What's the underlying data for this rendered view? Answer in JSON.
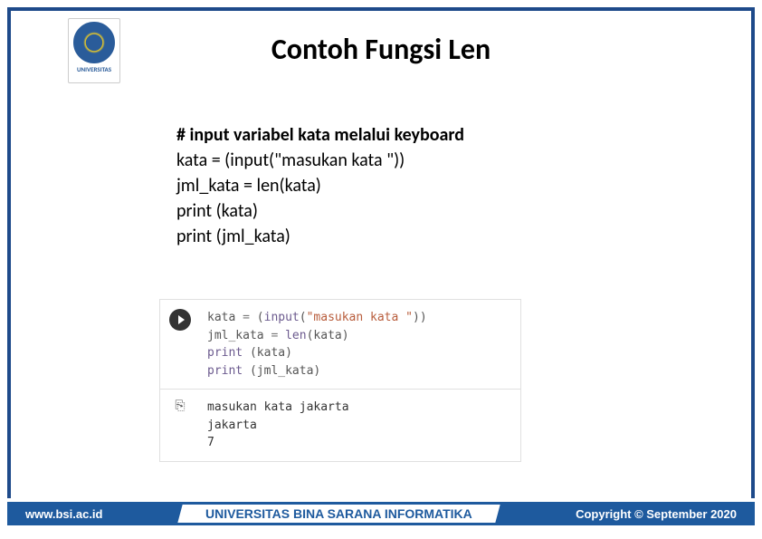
{
  "logo": {
    "label": "UNIVERSITAS"
  },
  "title": "Contoh Fungsi Len",
  "content": {
    "comment": "# input variabel kata melalui keyboard",
    "line2": "kata = (input(\"masukan kata \"))",
    "line3": "jml_kata = len(kata)",
    "line4": "print (kata)",
    "line5": "print (jml_kata)"
  },
  "code": {
    "line1": {
      "var": "kata",
      "eq": " = ",
      "open": "(",
      "fn": "input",
      "popen": "(",
      "str": "\"masukan kata \"",
      "pclose": "))"
    },
    "line2": {
      "var": "jml_kata",
      "eq": " = ",
      "fn": "len",
      "popen": "(",
      "arg": "kata",
      "pclose": ")"
    },
    "line3": {
      "fn": "print",
      "sp": " ",
      "popen": "(",
      "arg": "kata",
      "pclose": ")"
    },
    "line4": {
      "fn": "print",
      "sp": " ",
      "popen": "(",
      "arg": "jml_kata",
      "pclose": ")"
    }
  },
  "output": {
    "line1": "masukan kata jakarta",
    "line2": "jakarta",
    "line3": "7"
  },
  "footer": {
    "left": "www.bsi.ac.id",
    "center": "UNIVERSITAS BINA SARANA INFORMATIKA",
    "right": "Copyright © September 2020"
  }
}
